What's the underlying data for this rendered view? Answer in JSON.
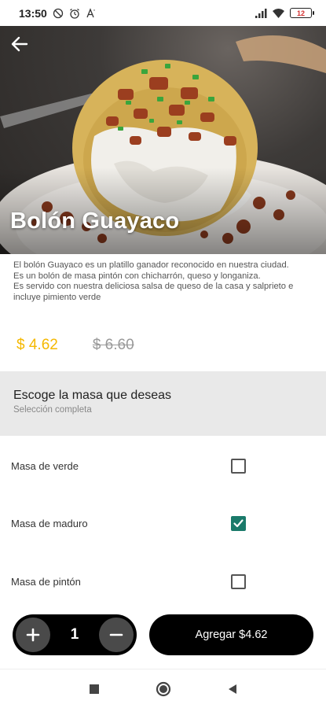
{
  "status_bar": {
    "time": "13:50",
    "battery": "12",
    "icons": [
      "no-disturb-icon",
      "alarm-icon",
      "text-icon",
      "signal-icon",
      "wifi-icon",
      "battery-icon"
    ]
  },
  "product": {
    "title": "Bolón Guayaco",
    "description": [
      "El bolón Guayaco es un platillo ganador reconocido en nuestra ciudad.",
      "Es un bolón de masa pintón con chicharrón, queso y longaniza.",
      "Es servido con nuestra deliciosa salsa de queso de la casa y salprieto e incluye pimiento verde"
    ],
    "price": "$ 4.62",
    "old_price": "$ 6.60"
  },
  "section": {
    "title": "Escoge la masa que deseas",
    "subtitle": "Selección completa"
  },
  "options": [
    {
      "label": "Masa de verde",
      "checked": false
    },
    {
      "label": "Masa de maduro",
      "checked": true
    },
    {
      "label": "Masa de pintón",
      "checked": false
    }
  ],
  "cart": {
    "quantity": "1",
    "add_label": "Agregar $4.62"
  },
  "colors": {
    "accent_price": "#f5b800",
    "checkbox_checked": "#1a7a6a",
    "button_bg": "#000000"
  }
}
